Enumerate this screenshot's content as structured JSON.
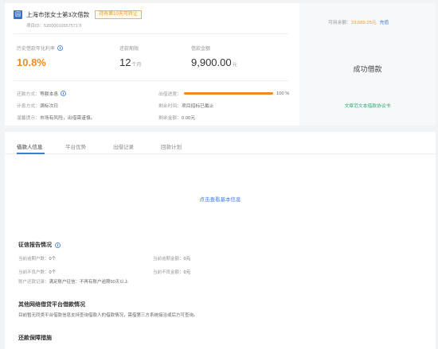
{
  "loan": {
    "icon_letter": "园",
    "title": "上海市张女士第3次借款",
    "badge": "持有第10天可转让",
    "project_id": "项目ID：520000105575717I"
  },
  "metrics": [
    {
      "label": "历史借款年化利率",
      "value": "10.8%",
      "unit": ""
    },
    {
      "label": "还款期限",
      "value": "12",
      "unit": "个月"
    },
    {
      "label": "借款金额",
      "value": "9,900.00",
      "unit": "元"
    }
  ],
  "details": {
    "repay_method_label": "还款方式：",
    "repay_method_value": "等额本息",
    "interest_label": "计息方式：",
    "interest_value": "满标次日",
    "risk_label": "温馨提示：",
    "risk_value": "市场有风险，出借需谨慎。",
    "progress_label": "出借进度：",
    "progress_percent_text": "100 %",
    "progress_fraction": 1.0,
    "deadline_label": "剩余时间：",
    "deadline_value": "项目招标已截止",
    "remain_label": "剩余金额：",
    "remain_value": "0.00元"
  },
  "account": {
    "available_label": "可用余额：",
    "available_amount": "23,689.25元",
    "recharge": "充值",
    "status": "成功借款",
    "contract_link": "文章范文本借款协议书"
  },
  "tabs": [
    {
      "label": "借款人信息",
      "active": true
    },
    {
      "label": "平台优势",
      "active": false
    },
    {
      "label": "出借记录",
      "active": false
    },
    {
      "label": "回款计划",
      "active": false
    }
  ],
  "borrower": {
    "view_basic": "点击查看基本信息"
  },
  "credit": {
    "title": "征信报告情况",
    "overdue_count_label": "当前逾期户数：",
    "overdue_count_value": "0个",
    "overdue_amount_label": "当前逾期金额：",
    "overdue_amount_value": "0元",
    "bad_count_label": "当前不良户数：",
    "bad_count_value": "0个",
    "bad_amount_label": "当前不良金额：",
    "bad_amount_value": "0元",
    "repay_label": "账户还款记录：",
    "repay_value": "满足账户征信：不再有账户逾期90天以上"
  },
  "other_platform": {
    "title": "其他网络借贷平台借款情况",
    "text": "目前暂无同类平台借款信息支持查询借款人的借款情况，需借第三方系统接洽或后方可查询。"
  },
  "guarantee": {
    "title": "还款保障措施"
  }
}
